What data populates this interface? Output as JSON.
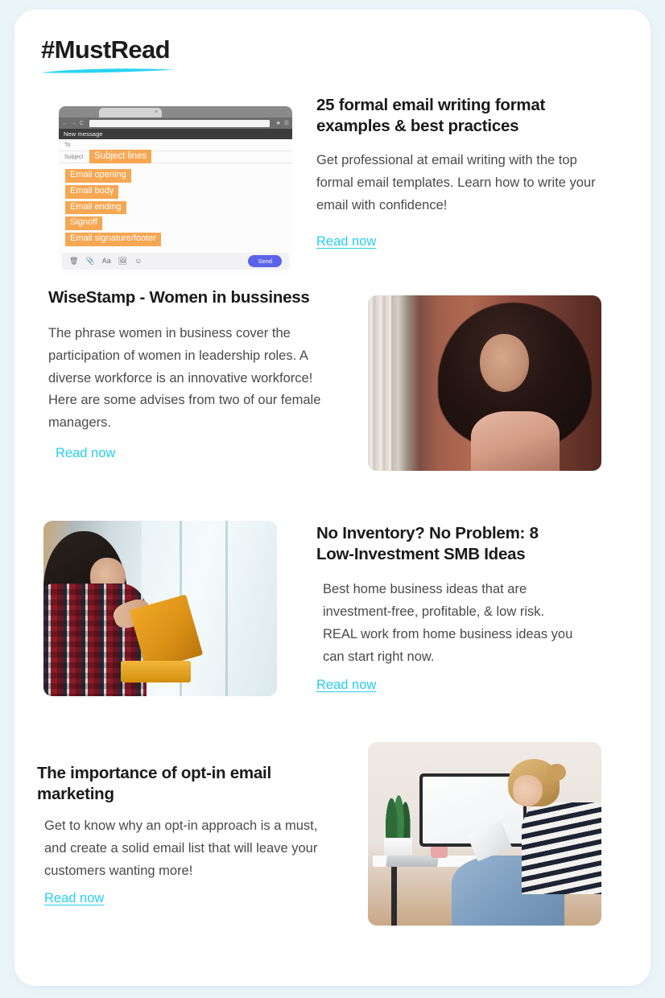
{
  "header": {
    "title": "#MustRead",
    "underline_color": "#29d2f2"
  },
  "theme": {
    "page_background": "#eaf5f8",
    "card_background": "#ffffff",
    "link_color": "#27cff0",
    "heading_color": "#1a1a1a",
    "body_color": "#4a4a4a",
    "tag_orange": "#f7a652",
    "send_button_blue": "#5b63e8"
  },
  "email_mockup": {
    "tab_close_label": "×",
    "nav_back": "←",
    "nav_forward": "→",
    "nav_reload": "C",
    "star_icon": "★",
    "menu_icon": "☰",
    "window_title": "New message",
    "field_to": "To",
    "field_subject": "Subject",
    "tags": [
      "Subject lines",
      "Email opening",
      "Email body",
      "Email ending",
      "Signoff",
      "Email signature/footer"
    ],
    "toolbar_icons": [
      "🗑",
      "📎",
      "Aa",
      "🖼",
      "☺"
    ],
    "send_label": "Send"
  },
  "articles": [
    {
      "title": "25 formal email writing format examples & best practices",
      "body": "Get professional at email writing with the top formal email templates. Learn how to write your email with confidence!",
      "link": "Read now"
    },
    {
      "title": "WiseStamp - Women in bussiness",
      "body": "The phrase women in business cover the participation of women in leadership roles. A diverse workforce is an innovative workforce!  Here are some advises from two of our female managers.",
      "link": "Read now"
    },
    {
      "title": "No Inventory? No Problem: 8 Low-Investment SMB Ideas",
      "body": "Best home business ideas that are investment-free, profitable, & low risk. REAL work from home business ideas you can start right now.",
      "link": "Read now"
    },
    {
      "title": "The importance of opt-in email marketing",
      "body": "Get to know why an opt-in approach is a must, and create a solid email list that will leave your customers wanting more!",
      "link": "Read now"
    }
  ]
}
